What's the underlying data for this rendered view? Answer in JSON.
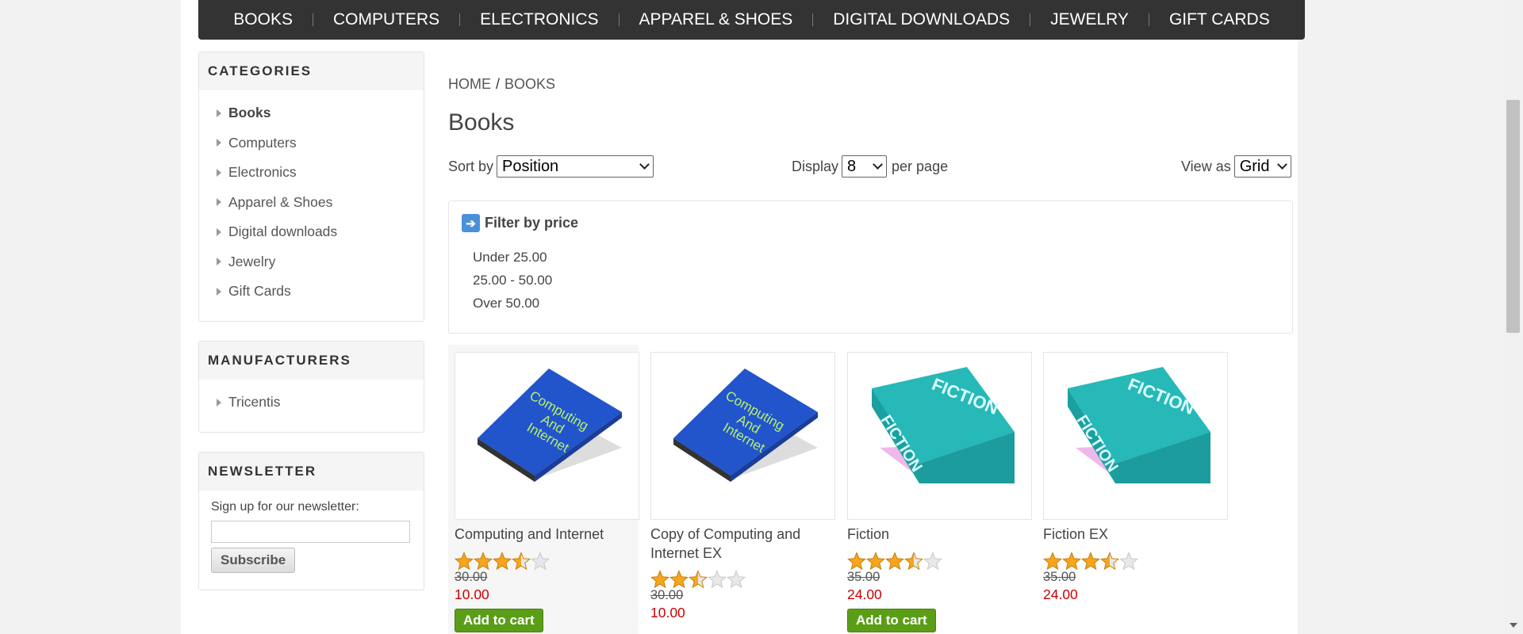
{
  "topmenu": [
    "BOOKS",
    "COMPUTERS",
    "ELECTRONICS",
    "APPAREL & SHOES",
    "DIGITAL DOWNLOADS",
    "JEWELRY",
    "GIFT CARDS"
  ],
  "categories": {
    "title": "CATEGORIES",
    "items": [
      "Books",
      "Computers",
      "Electronics",
      "Apparel & Shoes",
      "Digital downloads",
      "Jewelry",
      "Gift Cards"
    ]
  },
  "manufacturers": {
    "title": "MANUFACTURERS",
    "items": [
      "Tricentis"
    ]
  },
  "newsletter": {
    "title": "NEWSLETTER",
    "label": "Sign up for our newsletter:",
    "button": "Subscribe"
  },
  "breadcrumb": {
    "home": "HOME",
    "sep": "/",
    "current": "BOOKS"
  },
  "page_title": "Books",
  "sort": {
    "label": "Sort by",
    "value": "Position"
  },
  "display": {
    "label": "Display",
    "value": "8",
    "suffix": "per page"
  },
  "viewas": {
    "label": "View as",
    "value": "Grid"
  },
  "filter": {
    "title": "Filter by price",
    "options": [
      "Under 25.00",
      "25.00 - 50.00",
      "Over 50.00"
    ]
  },
  "products": [
    {
      "name": "Computing and Internet",
      "rating": 3.5,
      "old_price": "30.00",
      "price": "10.00",
      "cart": "Add to cart",
      "image": "computing-book"
    },
    {
      "name": "Copy of Computing and Internet EX",
      "rating": 2.5,
      "old_price": "30.00",
      "price": "10.00",
      "cart": "",
      "image": "computing-book"
    },
    {
      "name": "Fiction",
      "rating": 3.5,
      "old_price": "35.00",
      "price": "24.00",
      "cart": "Add to cart",
      "image": "fiction-book"
    },
    {
      "name": "Fiction EX",
      "rating": 3.5,
      "old_price": "35.00",
      "price": "24.00",
      "cart": "",
      "image": "fiction-book"
    }
  ],
  "colors": {
    "menu_bg": "#333333",
    "price_red": "#cc0000",
    "cart_green": "#5a9e17",
    "link_blue": "#4a90d9"
  }
}
